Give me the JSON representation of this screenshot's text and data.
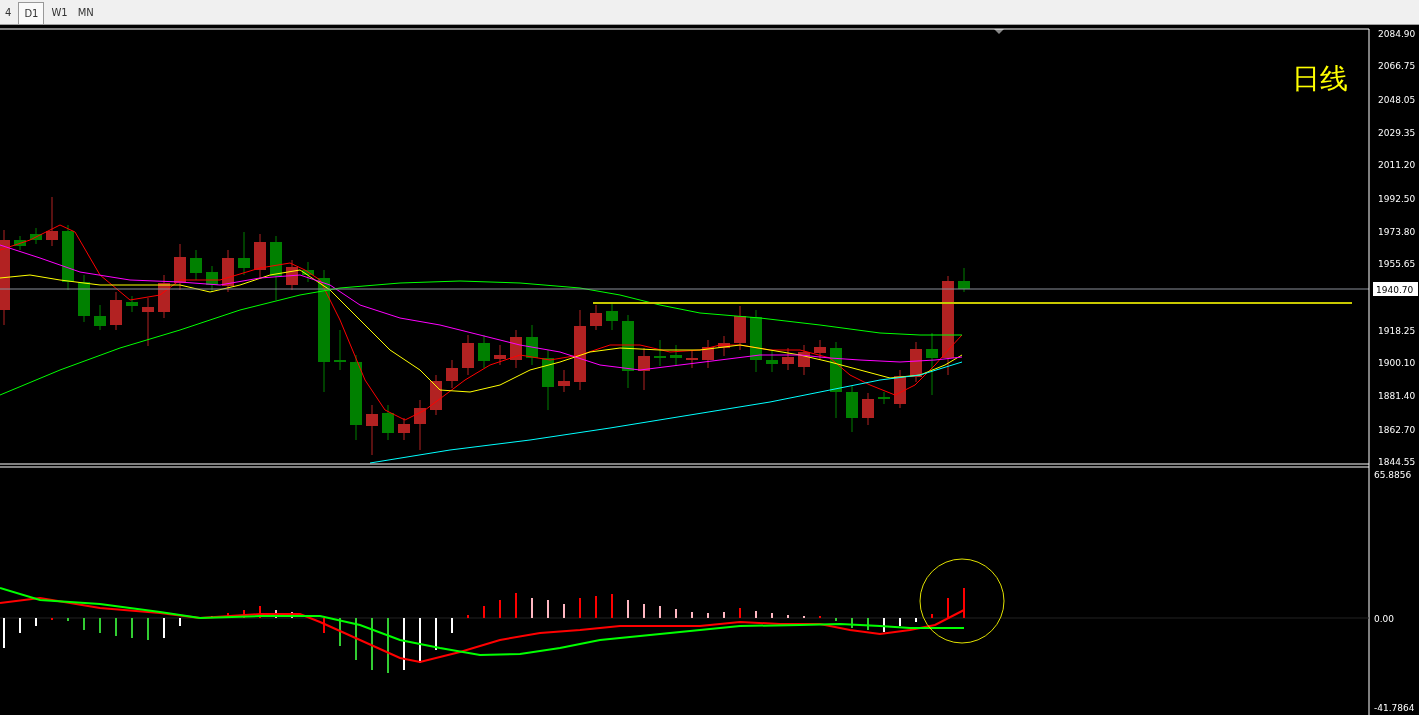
{
  "tabs": [
    {
      "label": "4",
      "selected": false
    },
    {
      "label": "D1",
      "selected": true
    },
    {
      "label": "W1",
      "selected": false
    },
    {
      "label": "MN",
      "selected": false
    }
  ],
  "chart_label": "日线",
  "price_axis": {
    "ticks": [
      "2084.90",
      "2066.75",
      "2048.05",
      "2029.35",
      "2011.20",
      "1992.50",
      "1973.80",
      "1955.65",
      "1918.25",
      "1900.10",
      "1881.40",
      "1862.70",
      "1844.55"
    ],
    "current_price": "1940.70"
  },
  "indicator_axis": {
    "ticks": [
      "65.8856",
      "0.00",
      "-41.7864"
    ]
  }
}
